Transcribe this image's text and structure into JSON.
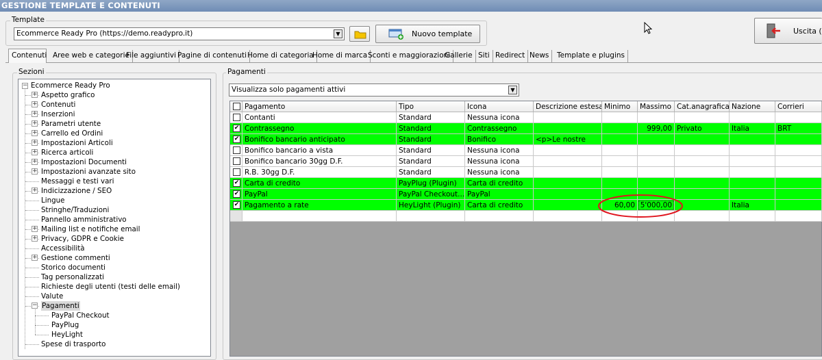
{
  "window": {
    "title": "GESTIONE TEMPLATE E CONTENUTI"
  },
  "template_group": {
    "label": "Template",
    "selected": "Ecommerce Ready Pro (https://demo.readypro.it)",
    "new_button": "Nuovo template",
    "exit_button": "Uscita (E"
  },
  "tabs": [
    "Contenuti",
    "Aree web e categorie",
    "File aggiuntivi",
    "Pagine di contenuti",
    "Home di categoria",
    "Home di marca",
    "Sconti e maggiorazioni",
    "Gallerie",
    "Siti",
    "Redirect",
    "News",
    "Template e plugins"
  ],
  "sections": {
    "label": "Sezioni",
    "root": "Ecommerce Ready Pro",
    "items": [
      {
        "label": "Aspetto grafico",
        "expander": "plus"
      },
      {
        "label": "Contenuti",
        "expander": "plus"
      },
      {
        "label": "Inserzioni",
        "expander": "plus"
      },
      {
        "label": "Parametri utente",
        "expander": "plus"
      },
      {
        "label": "Carrello ed Ordini",
        "expander": "plus"
      },
      {
        "label": "Impostazioni Articoli",
        "expander": "plus"
      },
      {
        "label": "Ricerca articoli",
        "expander": "plus"
      },
      {
        "label": "Impostazioni Documenti",
        "expander": "plus"
      },
      {
        "label": "Impostazioni avanzate sito",
        "expander": "plus"
      },
      {
        "label": "Messaggi e testi vari",
        "expander": ""
      },
      {
        "label": "Indicizzazione / SEO",
        "expander": "plus"
      },
      {
        "label": "Lingue",
        "expander": ""
      },
      {
        "label": "Stringhe/Traduzioni",
        "expander": ""
      },
      {
        "label": "Pannello amministrativo",
        "expander": ""
      },
      {
        "label": "Mailing list e notifiche email",
        "expander": "plus"
      },
      {
        "label": "Privacy, GDPR e Cookie",
        "expander": "plus"
      },
      {
        "label": "Accessibilità",
        "expander": ""
      },
      {
        "label": "Gestione commenti",
        "expander": "plus"
      },
      {
        "label": "Storico documenti",
        "expander": ""
      },
      {
        "label": "Tag personalizzati",
        "expander": ""
      },
      {
        "label": "Richieste degli utenti (testi delle email)",
        "expander": ""
      },
      {
        "label": "Valute",
        "expander": ""
      },
      {
        "label": "Pagamenti",
        "expander": "minus",
        "selected": true
      },
      {
        "label": "PayPal Checkout",
        "expander": "",
        "child": true
      },
      {
        "label": "PayPlug",
        "expander": "",
        "child": true
      },
      {
        "label": "HeyLight",
        "expander": "",
        "child": true
      },
      {
        "label": "Spese di trasporto",
        "expander": ""
      }
    ]
  },
  "payments": {
    "label": "Pagamenti",
    "filter": "Visualizza solo pagamenti attivi",
    "columns": [
      "Pagamento",
      "Tipo",
      "Icona",
      "Descrizione estesa",
      "Minimo",
      "Massimo",
      "Cat.anagrafica",
      "Nazione",
      "Corrieri"
    ],
    "rows": [
      {
        "checked": false,
        "active": false,
        "cells": [
          "Contanti",
          "Standard",
          "Nessuna icona",
          "",
          "",
          "",
          "",
          "",
          ""
        ]
      },
      {
        "checked": true,
        "active": true,
        "cells": [
          "Contrassegno",
          "Standard",
          "Contrassegno",
          "",
          "",
          "999,00",
          "Privato",
          "Italia",
          "BRT"
        ]
      },
      {
        "checked": true,
        "active": true,
        "cells": [
          "Bonifico bancario anticipato",
          "Standard",
          "Bonifico",
          "<p>Le nostre",
          "",
          "",
          "",
          "",
          ""
        ]
      },
      {
        "checked": false,
        "active": false,
        "cells": [
          "Bonifico bancario a vista",
          "Standard",
          "Nessuna icona",
          "",
          "",
          "",
          "",
          "",
          ""
        ]
      },
      {
        "checked": false,
        "active": false,
        "cells": [
          "Bonifico bancario 30gg D.F.",
          "Standard",
          "Nessuna icona",
          "",
          "",
          "",
          "",
          "",
          ""
        ]
      },
      {
        "checked": false,
        "active": false,
        "cells": [
          "R.B. 30gg D.F.",
          "Standard",
          "Nessuna icona",
          "",
          "",
          "",
          "",
          "",
          ""
        ]
      },
      {
        "checked": true,
        "active": true,
        "cells": [
          "Carta di credito",
          "PayPlug (Plugin)",
          "Carta di credito",
          "",
          "",
          "",
          "",
          "",
          ""
        ]
      },
      {
        "checked": true,
        "active": true,
        "cells": [
          "PayPal",
          "PayPal Checkout...",
          "PayPal",
          "",
          "",
          "",
          "",
          "",
          ""
        ]
      },
      {
        "checked": true,
        "active": true,
        "cells": [
          "Pagamento a rate",
          "HeyLight (Plugin)",
          "Carta di credito",
          "",
          "60,00",
          "5'000,00",
          "",
          "Italia",
          ""
        ]
      }
    ]
  },
  "colors": {
    "active_row": "#00ff00",
    "annotation": "#e0141e",
    "title_bar": "#7c97bd"
  }
}
